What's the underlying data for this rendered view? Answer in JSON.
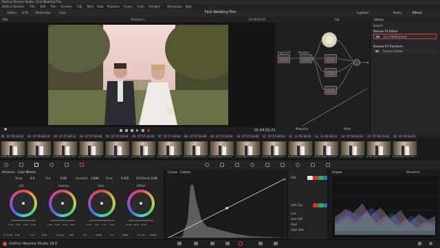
{
  "app": {
    "title": "DaVinci Resolve Studio - First Wedding Film",
    "footer": "DaVinci Resolve Studio 18.6"
  },
  "menu": [
    "DaVinci Resolve",
    "File",
    "Edit",
    "Trim",
    "Timeline",
    "Clip",
    "Mark",
    "View",
    "Playback",
    "Fusion",
    "Color",
    "Fairlight",
    "Workspace",
    "Help"
  ],
  "toolbar": {
    "left": [
      "Gallery",
      "LUTs",
      "Media Pool",
      "Clips"
    ],
    "center_title": "First Wedding Film",
    "right": [
      "Lightbox",
      "Nodes",
      "Effects"
    ]
  },
  "viewer": {
    "zoom": "36%",
    "timeline_name": "Timeline 1",
    "timecode_top": "07:59:02:01",
    "timecode": "01:04:55:21"
  },
  "nodebar": {
    "mode": "Clip"
  },
  "nodes": {
    "labels": [
      "Input LUT",
      "Parallax",
      "01",
      "02",
      "03",
      "04",
      "Magnolia",
      "Wide"
    ]
  },
  "library": {
    "tab": "Library",
    "search_label": "Search",
    "section_refine": "Resolve FX Refine",
    "item_refine": "Face Refinement",
    "section_transform": "Resolve FX Transform",
    "item_transform": "Camera Shake"
  },
  "clips": [
    {
      "num": "01",
      "tc": "07:56:26:02",
      "label": "H.264 High 4:2:2 L5.1"
    },
    {
      "num": "02",
      "tc": "07:56:46:10",
      "label": "H.264 High 4:2:2 L5.1"
    },
    {
      "num": "03",
      "tc": "07:57:30:12",
      "label": "H.264 High 4:2:2 L5.1"
    },
    {
      "num": "04",
      "tc": "07:57:34:04",
      "label": "H.264 High 4:2:2 L5.1"
    },
    {
      "num": "05",
      "tc": "07:57:34:04",
      "label": "H.264 High 4:2:2 L5.1"
    },
    {
      "num": "06",
      "tc": "07:57:34:04",
      "label": "H.264 High 4:2:2 L5.1"
    },
    {
      "num": "07",
      "tc": "07:57:34:04",
      "label": "H.264 High 4:2:2 L5.1"
    },
    {
      "num": "08",
      "tc": "07:57:34:04",
      "label": "H.264 High 4:2:2 L5.1"
    },
    {
      "num": "09",
      "tc": "07:57:34:04",
      "label": "H.264 High 4:2:2 L5.1"
    },
    {
      "num": "10",
      "tc": "07:57:34:04",
      "label": "H.264 High 4:2:2 L5.1"
    },
    {
      "num": "11",
      "tc": "07:57:34:04",
      "label": "H.264 High 4:2:2 L5.1"
    },
    {
      "num": "12",
      "tc": "11:59:38:15",
      "label": "H.264 High 4:2:2 L5.1"
    },
    {
      "num": "13",
      "tc": "11:56:30:12",
      "label": "H.264 High 4:2:2 L5.1"
    },
    {
      "num": "14",
      "tc": "07:59:02:01",
      "label": "H.264 High 4:2:2 L5.1"
    },
    {
      "num": "15",
      "tc": "07:59:10:01",
      "label": "H.264 High 4:2:2 L5.1"
    },
    {
      "num": "16",
      "tc": "07:59:12:01",
      "label": "H.264 High 4:2:2 L5.1"
    },
    {
      "num": "17",
      "tc": "19:07:13:15",
      "label": "H.264 High 4:2:2 L5.1"
    }
  ],
  "palettes": {
    "wheels_title": "Primaries - Color Wheels",
    "curves_title": "Curves - Custom",
    "scopes_title": "Scopes",
    "scope_type": "Waveform",
    "params_top": [
      {
        "label": "Temp",
        "value": "0.0"
      },
      {
        "label": "Tint",
        "value": "0.00"
      },
      {
        "label": "Contrast",
        "value": "1.000"
      },
      {
        "label": "Pivot",
        "value": "0.435"
      },
      {
        "label": "Mid/Detail",
        "value": "0.00"
      }
    ],
    "wheels": [
      {
        "name": "Lift",
        "values": [
          "0.00",
          "0.00",
          "0.00",
          "0.00"
        ]
      },
      {
        "name": "Gamma",
        "values": [
          "0.00",
          "0.00",
          "0.00",
          "0.00"
        ]
      },
      {
        "name": "Gain",
        "values": [
          "1.00",
          "1.00",
          "1.00",
          "1.00"
        ]
      },
      {
        "name": "Offset",
        "values": [
          "25.00",
          "25.00",
          "25.00",
          ""
        ]
      }
    ],
    "params_bottom": [
      {
        "label": "Col Boost",
        "value": "0.00"
      },
      {
        "label": "Shad",
        "value": "0.00"
      },
      {
        "label": "Hi/Light",
        "value": "0.00"
      },
      {
        "label": "Sat",
        "value": "50.00"
      },
      {
        "label": "Hue",
        "value": "50.00"
      },
      {
        "label": "Lum Mix",
        "value": "100.00"
      }
    ],
    "curve_ctl": {
      "edit_label": "Edit",
      "softclip_label": "Soft Clip",
      "rows": [
        "Low",
        "Low Soft",
        "High",
        "High Soft"
      ]
    }
  },
  "colors": {
    "accent": "#e04040",
    "panel": "#232326",
    "curve": "#e6e6e6"
  }
}
